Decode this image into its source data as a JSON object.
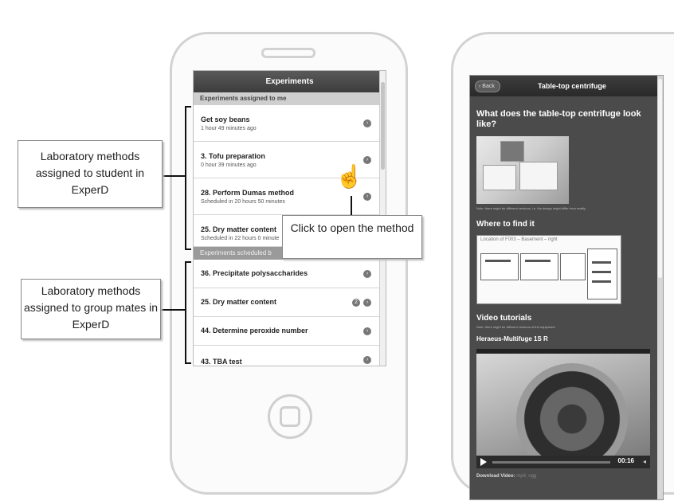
{
  "left_phone": {
    "header": "Experiments",
    "section_assigned": "Experiments assigned to me",
    "section_scheduled": "Experiments scheduled b",
    "assigned_items": [
      {
        "title": "Get soy beans",
        "subtitle": "1 hour 49 minutes ago"
      },
      {
        "title": "3. Tofu preparation",
        "subtitle": "0 hour 39 minutes ago"
      },
      {
        "title": "28. Perform Dumas method",
        "subtitle": "Scheduled in 20 hours 50 minutes"
      },
      {
        "title": "25. Dry matter content",
        "subtitle": "Scheduled in 22 hours 0 minute"
      }
    ],
    "group_items": [
      {
        "title": "36. Precipitate polysaccharides"
      },
      {
        "title": "25. Dry matter content",
        "badge": "2"
      },
      {
        "title": "44. Determine peroxide number"
      },
      {
        "title": "43. TBA test"
      }
    ]
  },
  "right_phone": {
    "back_label": "Back",
    "header": "Table-top centrifuge",
    "question": "What does the table-top centrifuge look like?",
    "note1": "Note: there might be different versions, i.e. the design might differ from reality.",
    "where_title": "Where to find it",
    "floorplan_label": "Location of F003 – Basement – right",
    "video_title": "Video tutorials",
    "note2": "Note: there might be different versions of the equipment",
    "video_name": "Heraeus-Multifuge 1S R",
    "video_time": "00:16",
    "download_label": "Download Video:",
    "download_links": "mp4, ogg"
  },
  "callouts": {
    "assigned_student": "Laboratory methods assigned to student in ExperD",
    "assigned_group": "Laboratory methods assigned to group mates in ExperD",
    "click_open": "Click to open the method"
  },
  "icons": [
    "chevron-right-icon",
    "hand-cursor-icon",
    "play-icon",
    "volume-icon",
    "back-arrow-icon"
  ]
}
